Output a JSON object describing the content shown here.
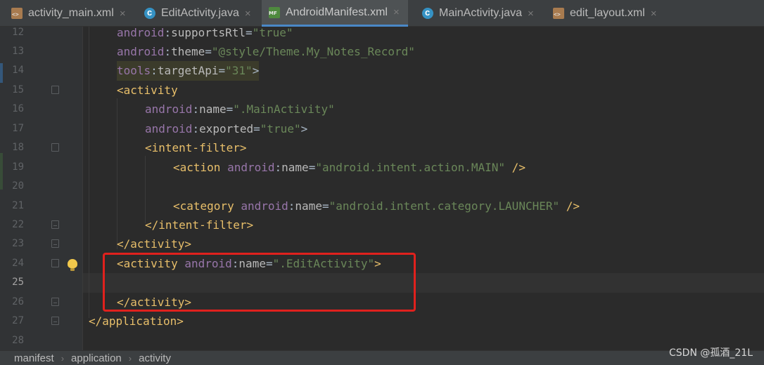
{
  "tabs": [
    {
      "label": "activity_main.xml",
      "icon": "xml-file-icon"
    },
    {
      "label": "EditActivity.java",
      "icon": "java-class-icon"
    },
    {
      "label": "AndroidManifest.xml",
      "icon": "manifest-file-icon",
      "active": true
    },
    {
      "label": "MainActivity.java",
      "icon": "java-class-icon"
    },
    {
      "label": "edit_layout.xml",
      "icon": "xml-file-icon"
    }
  ],
  "close_glyph": "×",
  "lines": [
    {
      "num": "12"
    },
    {
      "num": "13"
    },
    {
      "num": "14"
    },
    {
      "num": "15"
    },
    {
      "num": "16"
    },
    {
      "num": "17"
    },
    {
      "num": "18"
    },
    {
      "num": "19"
    },
    {
      "num": "20"
    },
    {
      "num": "21"
    },
    {
      "num": "22"
    },
    {
      "num": "23"
    },
    {
      "num": "24"
    },
    {
      "num": "25"
    },
    {
      "num": "26"
    },
    {
      "num": "27"
    },
    {
      "num": "28"
    }
  ],
  "code": {
    "l12": {
      "ns": "android",
      "attr": "supportsRtl",
      "val": "\"true\""
    },
    "l13": {
      "ns": "android",
      "attr": "theme",
      "val": "\"@style/Theme.My_Notes_Record\""
    },
    "l14": {
      "ns": "tools",
      "attr": "targetApi",
      "val": "\"31\"",
      "end": ">"
    },
    "l15": {
      "tag": "<activity"
    },
    "l16": {
      "ns": "android",
      "attr": "name",
      "val": "\".MainActivity\""
    },
    "l17": {
      "ns": "android",
      "attr": "exported",
      "val": "\"true\"",
      "end": ">"
    },
    "l18": {
      "tag": "<intent-filter>"
    },
    "l19": {
      "tag": "<action",
      "ns": "android",
      "attr": "name",
      "val": "\"android.intent.action.MAIN\"",
      "end": " />"
    },
    "l21": {
      "tag": "<category",
      "ns": "android",
      "attr": "name",
      "val": "\"android.intent.category.LAUNCHER\"",
      "end": " />"
    },
    "l22": {
      "tag": "</intent-filter>"
    },
    "l23": {
      "tag": "</activity>"
    },
    "l24": {
      "tag": "<activity",
      "ns": "android",
      "attr": "name",
      "val": "\".EditActivity\"",
      "end": ">"
    },
    "l26": {
      "tag": "</activity>"
    },
    "l27": {
      "tag": "</application>"
    }
  },
  "syntax_colors": {
    "tag": "#e8bf6a",
    "namespace": "#9876aa",
    "attribute": "#bababa",
    "string": "#6a8759",
    "highlight_box": "#e0211d"
  },
  "breadcrumb": [
    "manifest",
    "application",
    "activity"
  ],
  "breadcrumb_sep": "›",
  "watermark": "CSDN @孤酒_21L"
}
